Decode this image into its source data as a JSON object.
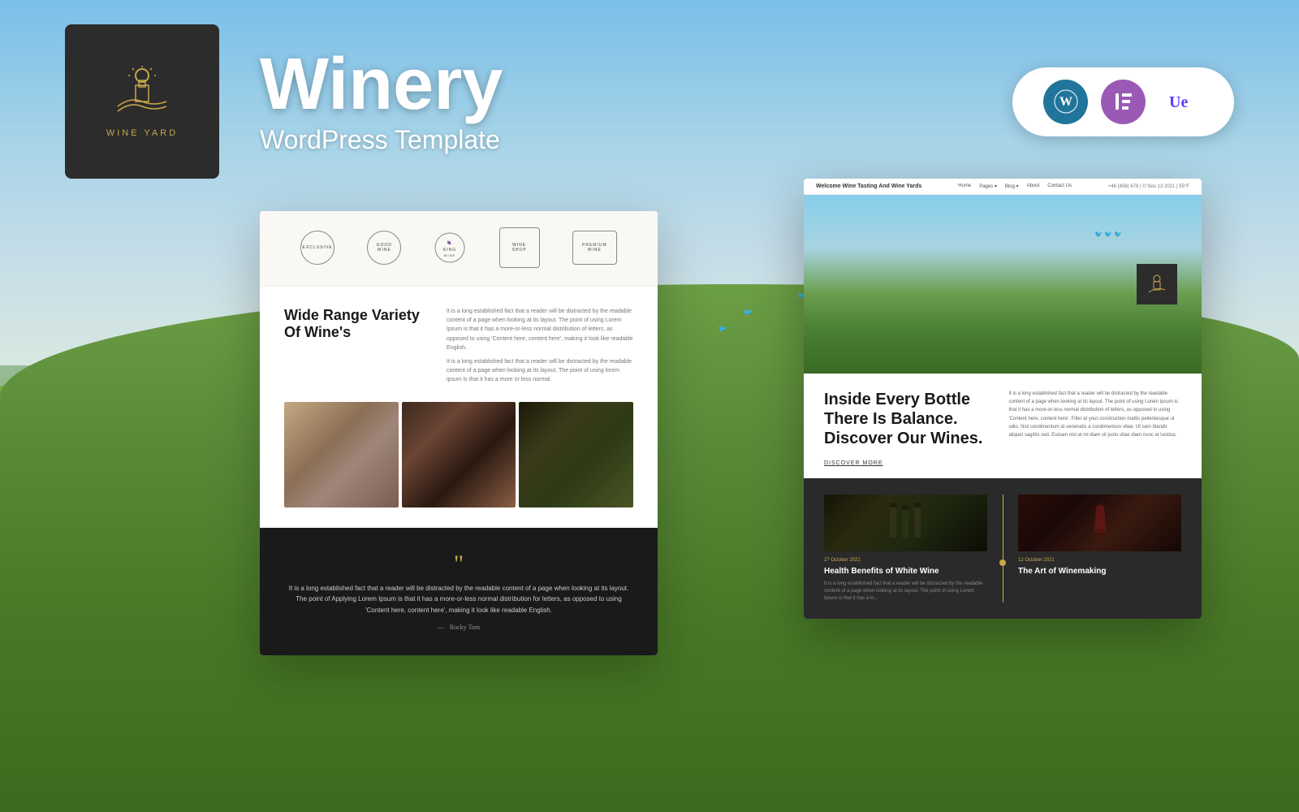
{
  "background": {
    "sky_color": "#87CEEB",
    "hills_color": "#5A8A38"
  },
  "header": {
    "logo_text": "WINE YARD",
    "title": "Winery",
    "subtitle": "WordPress Template"
  },
  "platforms": {
    "wordpress_label": "WordPress",
    "elementor_label": "Elementor",
    "ue_label": "Ultimate Elementor"
  },
  "preview_left": {
    "brands": [
      {
        "name": "EXCLUSIVE",
        "shape": "circle"
      },
      {
        "name": "GOOD WINE",
        "shape": "circle"
      },
      {
        "name": "KING WINE",
        "shape": "grape"
      },
      {
        "name": "WINE SHOP",
        "shape": "wreath"
      },
      {
        "name": "PREMIUM WINE",
        "shape": "circle"
      }
    ],
    "section_title": "Wide Range Variety Of Wine's",
    "body_text_1": "It is a long established fact that a reader will be distracted by the readable content of a page when looking at its layout. The point of using Lorem Ipsum is that it has a more-or-less normal distribution of letters, as opposed to using 'Content here, content here', making it look like readable English.",
    "body_text_2": "It is a long established fact that a reader will be distracted by the readable content of a page when looking at its layout. The point of using lorem ipsum is that it has a more or less normal.",
    "images": [
      {
        "alt": "Woman with wine",
        "id": "img-woman"
      },
      {
        "alt": "Wine glass closeup",
        "id": "img-glass"
      },
      {
        "alt": "Grapes on vine",
        "id": "img-grapes"
      }
    ],
    "quote": "It is a long established fact that a reader will be distracted by the readable content of a page when looking at its layout. The point of Applying Lorem Ipsum is that it has a more-or-less normal distribution for letters, as opposed to using 'Content here, content here', making it look like readable English.",
    "quote_author": "Rocky Tom"
  },
  "preview_right": {
    "nav": {
      "brand": "Welcome Wine Tasting And Wine Yards",
      "links": [
        "Home",
        "Pages",
        "Blog",
        "About",
        "Contact Us"
      ],
      "contact": "+46 (456) 678 | © Nov 13 2021  |  55°F"
    },
    "hero": {
      "logo_icon": "🏛"
    },
    "section_title": "Inside Every Bottle There Is Balance. Discover Our Wines.",
    "discover_link": "DISCOVER MORE",
    "body_text": "It is a long established fact that a reader will be distracted by the readable content of a page when looking at its layout. The point of using Lorem ipsum is that it has a more-or-less normal distribution of letters, as opposed to using 'Content here, content here'. Filler at your construction mattis pellentesque ut odio. Nisl condimentum id venenatis a condimentum vitae. Ut sem blandit aliquet sagittis sed. Euisam nisl at mi diam sit justo vitae diam nunc et lucidus.",
    "blog_posts": [
      {
        "date": "27 October 2021",
        "title": "Health Benefits of White Wine",
        "excerpt": "It is a long established fact that a reader will be distracted by the readable content of a page when looking at its layout. The point of using Lorem Ipsum is that it has a to..."
      },
      {
        "date": "12 October 2021",
        "title": "The Art of Winemaking",
        "excerpt": ""
      }
    ]
  }
}
